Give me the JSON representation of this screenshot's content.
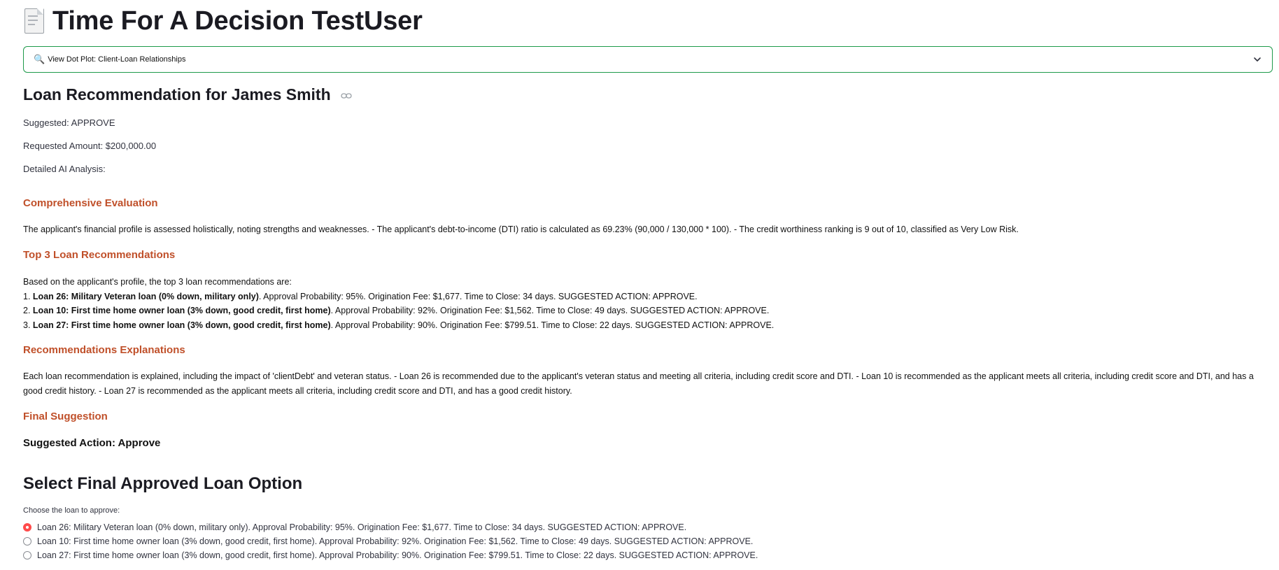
{
  "header": {
    "title": "Time For A Decision TestUser",
    "icon": "page-document-icon"
  },
  "expander": {
    "label": "View Dot Plot: Client-Loan Relationships",
    "icon": "magnifier-icon"
  },
  "recommendation": {
    "title": "Loan Recommendation for James Smith",
    "suggested": "Suggested: APPROVE",
    "requested": "Requested Amount: $200,000.00",
    "analysis_label": "Detailed AI Analysis:"
  },
  "sections": {
    "evaluation": {
      "heading": "Comprehensive Evaluation",
      "body": "The applicant's financial profile is assessed holistically, noting strengths and weaknesses. - The applicant's debt-to-income (DTI) ratio is calculated as 69.23% (90,000 / 130,000 * 100). - The credit worthiness ranking is 9 out of 10, classified as Very Low Risk."
    },
    "top3": {
      "heading": "Top 3 Loan Recommendations",
      "intro": "Based on the applicant's profile, the top 3 loan recommendations are:",
      "items": [
        {
          "num": "1.",
          "name": "Loan 26: Military Veteran loan (0% down, military only)",
          "detail": ". Approval Probability: 95%. Origination Fee: $1,677. Time to Close: 34 days. SUGGESTED ACTION: APPROVE."
        },
        {
          "num": "2.",
          "name": "Loan 10: First time home owner loan (3% down, good credit, first home)",
          "detail": ". Approval Probability: 92%. Origination Fee: $1,562. Time to Close: 49 days. SUGGESTED ACTION: APPROVE."
        },
        {
          "num": "3.",
          "name": "Loan 27: First time home owner loan (3% down, good credit, first home)",
          "detail": ". Approval Probability: 90%. Origination Fee: $799.51. Time to Close: 22 days. SUGGESTED ACTION: APPROVE."
        }
      ]
    },
    "explanations": {
      "heading": "Recommendations Explanations",
      "body": "Each loan recommendation is explained, including the impact of 'clientDebt' and veteran status. - Loan 26 is recommended due to the applicant's veteran status and meeting all criteria, including credit score and DTI. - Loan 10 is recommended as the applicant meets all criteria, including credit score and DTI, and has a good credit history. - Loan 27 is recommended as the applicant meets all criteria, including credit score and DTI, and has a good credit history."
    },
    "final": {
      "heading": "Final Suggestion",
      "action": "Suggested Action: Approve"
    }
  },
  "selection": {
    "title": "Select Final Approved Loan Option",
    "prompt": "Choose the loan to approve:",
    "selected_index": 0,
    "options": [
      "Loan 26: Military Veteran loan (0% down, military only). Approval Probability: 95%. Origination Fee: $1,677. Time to Close: 34 days. SUGGESTED ACTION: APPROVE.",
      "Loan 10: First time home owner loan (3% down, good credit, first home). Approval Probability: 92%. Origination Fee: $1,562. Time to Close: 49 days. SUGGESTED ACTION: APPROVE.",
      "Loan 27: First time home owner loan (3% down, good credit, first home). Approval Probability: 90%. Origination Fee: $799.51. Time to Close: 22 days. SUGGESTED ACTION: APPROVE."
    ]
  },
  "colors": {
    "accent_heading": "#c0502a",
    "expander_border": "#1e9a4a",
    "radio_selected": "#ff4b4b"
  }
}
